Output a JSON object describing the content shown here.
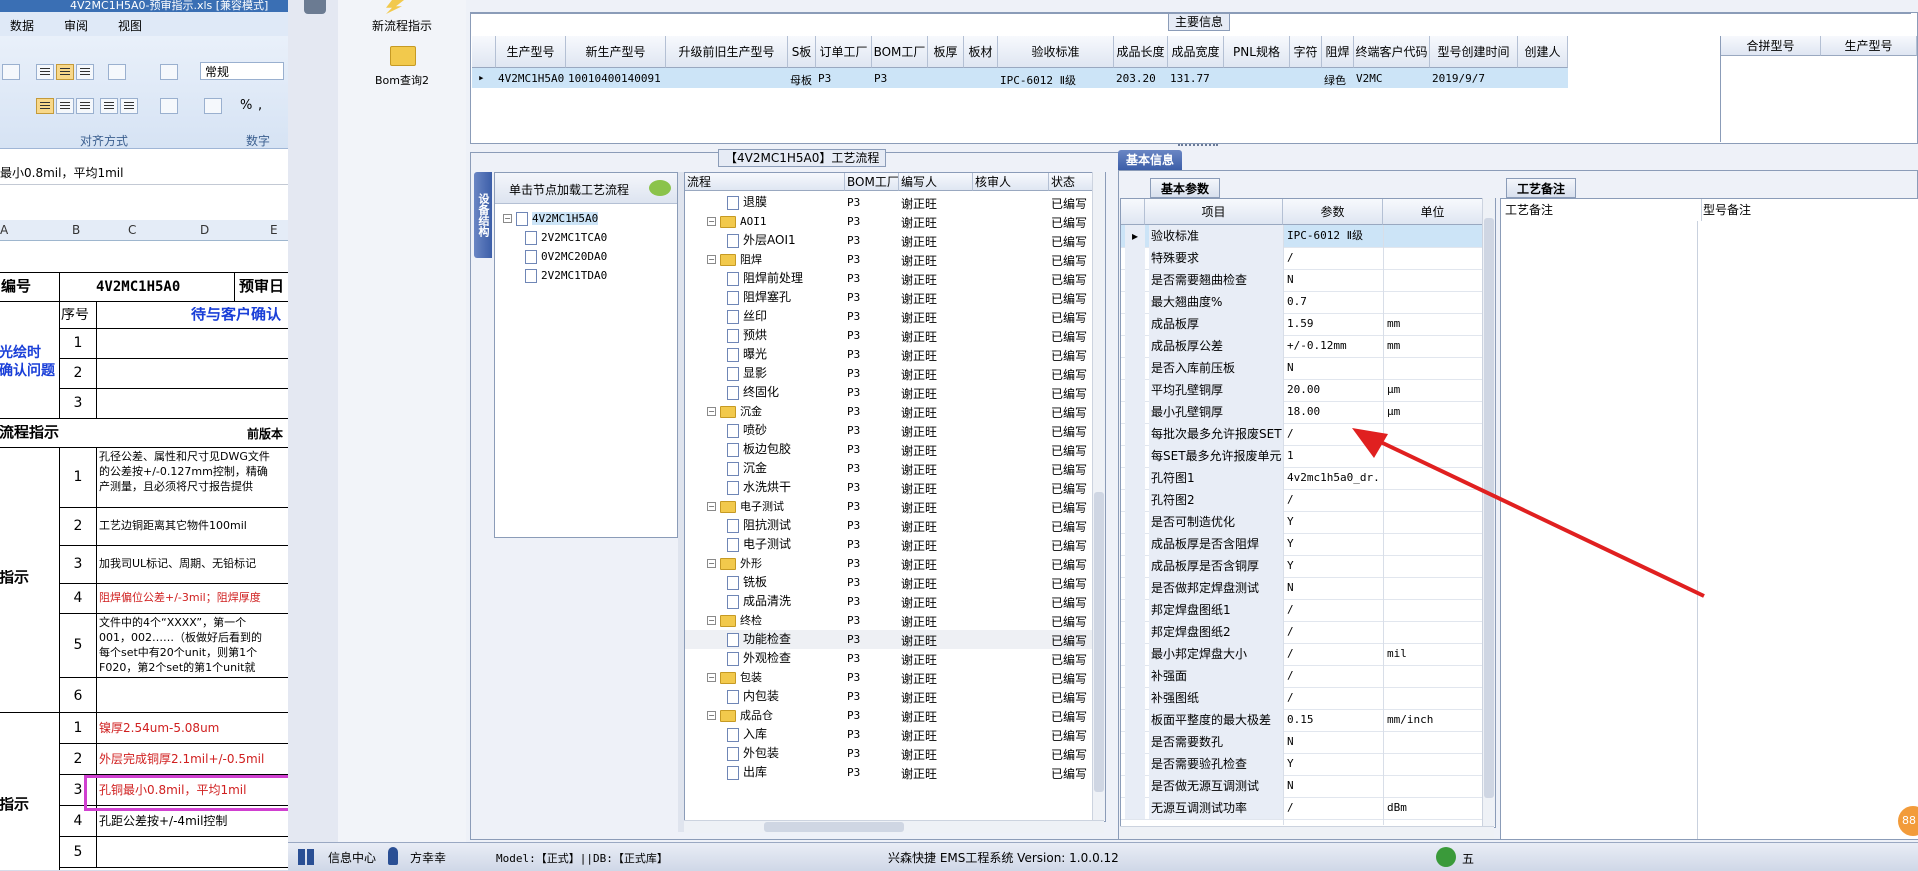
{
  "excel": {
    "title": "4V2MC1H5A0-预审指示.xls  [兼容模式]",
    "menu": [
      "数据",
      "审阅",
      "视图"
    ],
    "font_style": "常规",
    "align_group": "对齐方式",
    "number_group": "数字",
    "formula": "最小0.8mil，平均1mil",
    "columns": [
      "A",
      "B",
      "C",
      "D",
      "E"
    ],
    "part_label": "编号",
    "part_no": "4V2MC1H5A0",
    "review_label": "预审日",
    "seq_header": "序号",
    "confirm_header": "待与客户确认",
    "section1": "光绘时\n确认问题",
    "section2": "流程指示",
    "front_label": "前版本",
    "section3": "指示",
    "section4": "指示",
    "rows": [
      {
        "n": "1",
        "t": ""
      },
      {
        "n": "2",
        "t": ""
      },
      {
        "n": "3",
        "t": ""
      }
    ],
    "flow_rows": [
      {
        "n": "1",
        "t1": "孔径公差、属性和尺寸见DWG文件",
        "t2": "的公差按+/-0.127mm控制，精确",
        "t3": "产测量，且必须将尺寸报告提供"
      },
      {
        "n": "2",
        "t1": "工艺边铜距离其它物件100mil"
      },
      {
        "n": "3",
        "t1": "加我司UL标记、周期、无铅标记"
      },
      {
        "n": "4",
        "t1": "阻焊偏位公差+/-3mil；阻焊厚度"
      },
      {
        "n": "5",
        "t1": "文件中的4个“XXXX”，第一个",
        "t2": "001，002……（板做好后看到的",
        "t3": "每个set中有20个unit，则第1个",
        "t4": "F020，第2个set的第1个unit就"
      },
      {
        "n": "6",
        "t1": ""
      }
    ],
    "spec_rows": [
      {
        "n": "1",
        "t": "镍厚2.54um-5.08um"
      },
      {
        "n": "2",
        "t": "外层完成铜厚2.1mil+/-0.5mil"
      },
      {
        "n": "3",
        "t": "孔铜最小0.8mil，平均1mil"
      },
      {
        "n": "4",
        "t": "孔距公差按+/-4mil控制"
      },
      {
        "n": "5",
        "t": ""
      }
    ]
  },
  "toolbar": {
    "new_flow": "新流程指示",
    "bom_query": "Bom查询2"
  },
  "main_info": {
    "caption": "主要信息",
    "headers": [
      "生产型号",
      "新生产型号",
      "升级前旧生产型号",
      "S板",
      "订单工厂",
      "BOM工厂",
      "板厚",
      "板材",
      "验收标准",
      "成品长度",
      "成品宽度",
      "PNL规格",
      "字符",
      "阻焊",
      "终端客户代码",
      "型号创建时间",
      "创建人"
    ],
    "row": [
      "4V2MC1H5A0",
      "10010400140091",
      "",
      "母板",
      "P3",
      "P3",
      "",
      "",
      "IPC-6012 Ⅱ级",
      "203.20",
      "131.77",
      "",
      "",
      "绿色",
      "V2MC",
      "2019/9/7",
      ""
    ],
    "merge_headers": [
      "合拼型号",
      "生产型号"
    ]
  },
  "process": {
    "caption": "【4V2MC1H5A0】工艺流程",
    "side_tab": "设备结构",
    "load_hint": "单击节点加载工艺流程",
    "tree": [
      "4V2MC1H5A0",
      "2V2MC1TCA0",
      "0V2MC20DA0",
      "2V2MC1TDA0"
    ],
    "headers": [
      "流程",
      "BOM工厂",
      "编写人",
      "核审人",
      "状态"
    ],
    "rows": [
      {
        "lvl": 2,
        "folder": false,
        "name": "退膜",
        "f": "P3",
        "w": "谢正旺",
        "s": "已编写"
      },
      {
        "lvl": 1,
        "folder": true,
        "name": "AOI1",
        "f": "P3",
        "w": "谢正旺",
        "s": "已编写"
      },
      {
        "lvl": 2,
        "folder": false,
        "name": "外层AOI1",
        "f": "P3",
        "w": "谢正旺",
        "s": "已编写"
      },
      {
        "lvl": 1,
        "folder": true,
        "name": "阻焊",
        "f": "P3",
        "w": "谢正旺",
        "s": "已编写"
      },
      {
        "lvl": 2,
        "folder": false,
        "name": "阻焊前处理",
        "f": "P3",
        "w": "谢正旺",
        "s": "已编写"
      },
      {
        "lvl": 2,
        "folder": false,
        "name": "阻焊塞孔",
        "f": "P3",
        "w": "谢正旺",
        "s": "已编写"
      },
      {
        "lvl": 2,
        "folder": false,
        "name": "丝印",
        "f": "P3",
        "w": "谢正旺",
        "s": "已编写"
      },
      {
        "lvl": 2,
        "folder": false,
        "name": "预烘",
        "f": "P3",
        "w": "谢正旺",
        "s": "已编写"
      },
      {
        "lvl": 2,
        "folder": false,
        "name": "曝光",
        "f": "P3",
        "w": "谢正旺",
        "s": "已编写"
      },
      {
        "lvl": 2,
        "folder": false,
        "name": "显影",
        "f": "P3",
        "w": "谢正旺",
        "s": "已编写"
      },
      {
        "lvl": 2,
        "folder": false,
        "name": "终固化",
        "f": "P3",
        "w": "谢正旺",
        "s": "已编写"
      },
      {
        "lvl": 1,
        "folder": true,
        "name": "沉金",
        "f": "P3",
        "w": "谢正旺",
        "s": "已编写"
      },
      {
        "lvl": 2,
        "folder": false,
        "name": "喷砂",
        "f": "P3",
        "w": "谢正旺",
        "s": "已编写"
      },
      {
        "lvl": 2,
        "folder": false,
        "name": "板边包胶",
        "f": "P3",
        "w": "谢正旺",
        "s": "已编写"
      },
      {
        "lvl": 2,
        "folder": false,
        "name": "沉金",
        "f": "P3",
        "w": "谢正旺",
        "s": "已编写"
      },
      {
        "lvl": 2,
        "folder": false,
        "name": "水洗烘干",
        "f": "P3",
        "w": "谢正旺",
        "s": "已编写"
      },
      {
        "lvl": 1,
        "folder": true,
        "name": "电子测试",
        "f": "P3",
        "w": "谢正旺",
        "s": "已编写"
      },
      {
        "lvl": 2,
        "folder": false,
        "name": "阻抗测试",
        "f": "P3",
        "w": "谢正旺",
        "s": "已编写"
      },
      {
        "lvl": 2,
        "folder": false,
        "name": "电子测试",
        "f": "P3",
        "w": "谢正旺",
        "s": "已编写"
      },
      {
        "lvl": 1,
        "folder": true,
        "name": "外形",
        "f": "P3",
        "w": "谢正旺",
        "s": "已编写"
      },
      {
        "lvl": 2,
        "folder": false,
        "name": "铣板",
        "f": "P3",
        "w": "谢正旺",
        "s": "已编写"
      },
      {
        "lvl": 2,
        "folder": false,
        "name": "成品清洗",
        "f": "P3",
        "w": "谢正旺",
        "s": "已编写"
      },
      {
        "lvl": 1,
        "folder": true,
        "name": "终检",
        "f": "P3",
        "w": "谢正旺",
        "s": "已编写"
      },
      {
        "lvl": 2,
        "folder": false,
        "name": "功能检查",
        "f": "P3",
        "w": "谢正旺",
        "s": "已编写"
      },
      {
        "lvl": 2,
        "folder": false,
        "name": "外观检查",
        "f": "P3",
        "w": "谢正旺",
        "s": "已编写"
      },
      {
        "lvl": 1,
        "folder": true,
        "name": "包装",
        "f": "P3",
        "w": "谢正旺",
        "s": "已编写"
      },
      {
        "lvl": 2,
        "folder": false,
        "name": "内包装",
        "f": "P3",
        "w": "谢正旺",
        "s": "已编写"
      },
      {
        "lvl": 1,
        "folder": true,
        "name": "成品仓",
        "f": "P3",
        "w": "谢正旺",
        "s": "已编写"
      },
      {
        "lvl": 2,
        "folder": false,
        "name": "入库",
        "f": "P3",
        "w": "谢正旺",
        "s": "已编写"
      },
      {
        "lvl": 2,
        "folder": false,
        "name": "外包装",
        "f": "P3",
        "w": "谢正旺",
        "s": "已编写"
      },
      {
        "lvl": 2,
        "folder": false,
        "name": "出库",
        "f": "P3",
        "w": "谢正旺",
        "s": "已编写"
      }
    ]
  },
  "basic": {
    "tab": "基本信息",
    "subtab": "基本参数",
    "headers": [
      "项目",
      "参数",
      "单位"
    ],
    "rows": [
      {
        "k": "验收标准",
        "v": "IPC-6012 Ⅱ级",
        "u": ""
      },
      {
        "k": "特殊要求",
        "v": "/",
        "u": ""
      },
      {
        "k": "是否需要翘曲检查",
        "v": "N",
        "u": ""
      },
      {
        "k": "最大翘曲度%",
        "v": "0.7",
        "u": ""
      },
      {
        "k": "成品板厚",
        "v": "1.59",
        "u": "mm"
      },
      {
        "k": "成品板厚公差",
        "v": "+/-0.12mm",
        "u": "mm"
      },
      {
        "k": "是否入库前压板",
        "v": "N",
        "u": ""
      },
      {
        "k": "平均孔壁铜厚",
        "v": "20.00",
        "u": "μm"
      },
      {
        "k": "最小孔壁铜厚",
        "v": "18.00",
        "u": "μm"
      },
      {
        "k": "每批次最多允许报废SET",
        "v": "/",
        "u": ""
      },
      {
        "k": "每SET最多允许报废单元",
        "v": "1",
        "u": ""
      },
      {
        "k": "孔符图1",
        "v": "4v2mc1h5a0_dr...",
        "u": ""
      },
      {
        "k": "孔符图2",
        "v": "/",
        "u": ""
      },
      {
        "k": "是否可制造优化",
        "v": "Y",
        "u": ""
      },
      {
        "k": "成品板厚是否含阻焊",
        "v": "Y",
        "u": ""
      },
      {
        "k": "成品板厚是否含铜厚",
        "v": "Y",
        "u": ""
      },
      {
        "k": "是否做邦定焊盘测试",
        "v": "N",
        "u": ""
      },
      {
        "k": "邦定焊盘图纸1",
        "v": "/",
        "u": ""
      },
      {
        "k": "邦定焊盘图纸2",
        "v": "/",
        "u": ""
      },
      {
        "k": "最小邦定焊盘大小",
        "v": "/",
        "u": "mil"
      },
      {
        "k": "补强面",
        "v": "/",
        "u": ""
      },
      {
        "k": "补强图纸",
        "v": "/",
        "u": ""
      },
      {
        "k": "板面平整度的最大极差",
        "v": "0.15",
        "u": "mm/inch"
      },
      {
        "k": "是否需要数孔",
        "v": "N",
        "u": ""
      },
      {
        "k": "是否需要验孔检查",
        "v": "Y",
        "u": ""
      },
      {
        "k": "是否做无源互调测试",
        "v": "N",
        "u": ""
      },
      {
        "k": "无源互调测试功率",
        "v": "/",
        "u": "dBm"
      }
    ]
  },
  "remarks": {
    "tab": "工艺备注",
    "col1": "工艺备注",
    "col2": "型号备注"
  },
  "status": {
    "info_center": "信息中心",
    "user": "方幸幸",
    "model": "Model:【正式】||DB:【正式库】",
    "system": "兴森快捷  EMS工程系统  Version: 1.0.0.12",
    "ime": "五",
    "badge": "88"
  },
  "colors": {
    "selection": "#cce4f7",
    "arrow": "#e02020",
    "highlight_box": "#d040d0"
  }
}
